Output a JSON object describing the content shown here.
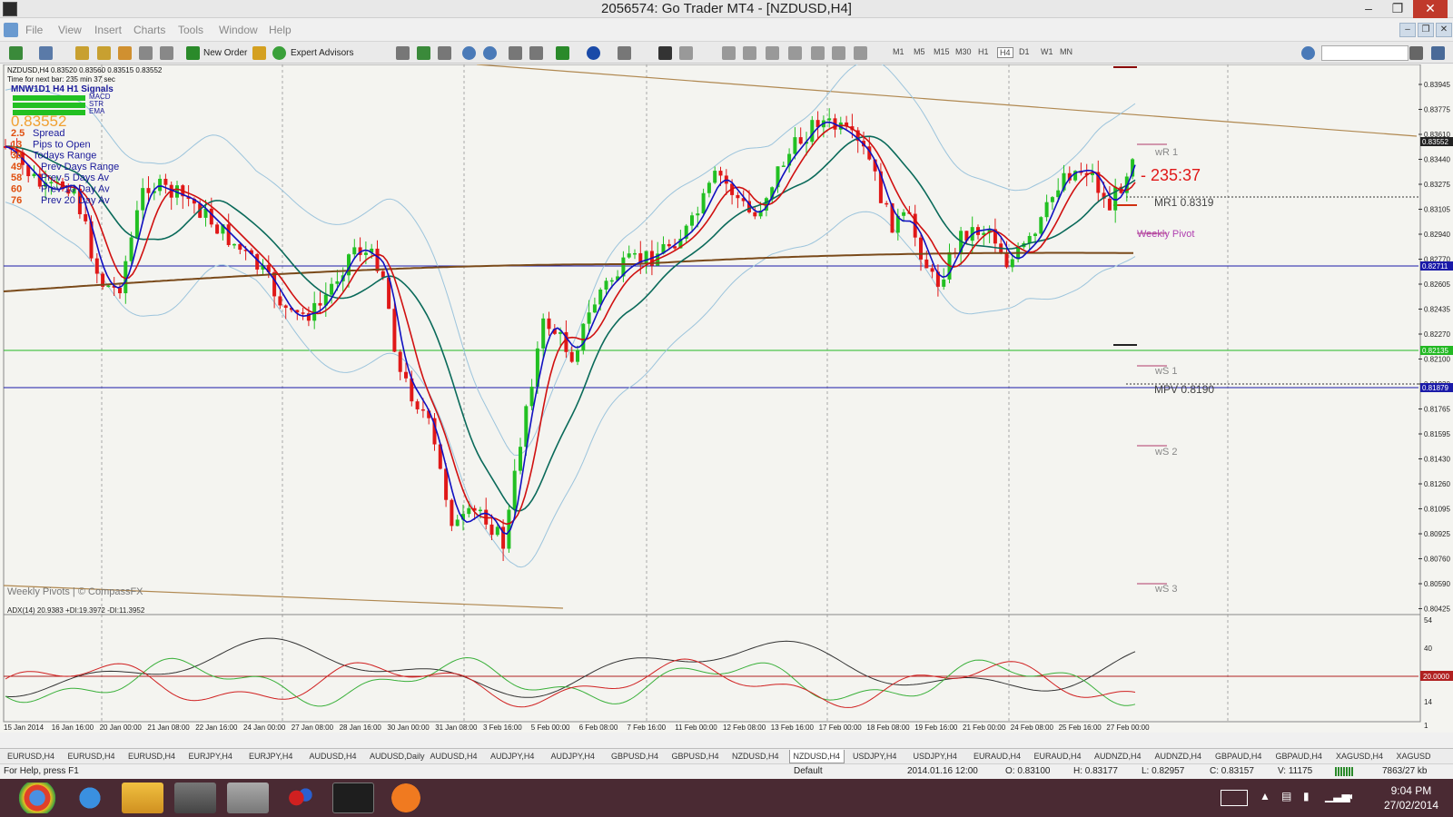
{
  "window": {
    "title": "2056574: Go Trader MT4 - [NZDUSD,H4]",
    "minimize": "–",
    "maximize": "❐",
    "close": "✕"
  },
  "menu": [
    "File",
    "View",
    "Insert",
    "Charts",
    "Tools",
    "Window",
    "Help"
  ],
  "toolbar": {
    "new_order": "New Order",
    "expert_advisors": "Expert Advisors",
    "timeframes": [
      "M1",
      "M5",
      "M15",
      "M30",
      "H1",
      "H4",
      "D1",
      "W1",
      "MN"
    ]
  },
  "chart": {
    "header": "NZDUSD,H4  0.83520 0.83560 0.83515 0.83552",
    "timer_line": "Time for next bar: 235 min 37 sec",
    "signals": "MNW1D1 H4 H1  Signals",
    "signal_rows": [
      "MACD",
      "STR",
      "EMA"
    ],
    "price_big": "0.83552",
    "info_rows": [
      {
        "value": "2.5",
        "label": "Spread"
      },
      {
        "value": "13",
        "label": "Pips to Open"
      },
      {
        "value": "38",
        "label": "Todays Range"
      },
      {
        "value": "49",
        "label": "Prev Days Range"
      },
      {
        "value": "58",
        "label": "Prev 5 Days Av"
      },
      {
        "value": "60",
        "label": "Prev 10 Day Av"
      },
      {
        "value": "76",
        "label": "Prev 20 Day Av"
      }
    ],
    "countdown": "- 235:37",
    "pivot_labels": {
      "wr1": "wR 1",
      "mr1": "MR1   0.8319",
      "weekly_pivot": "Weekly Pivot",
      "ws1": "wS 1",
      "mpv": "MPV   0.8190",
      "ws2": "wS 2",
      "ws3": "wS 3"
    },
    "watermark": "Weekly Pivots | © CompassFX",
    "price_scale": [
      "0.83945",
      "0.83775",
      "0.83610",
      "0.83440",
      "0.83275",
      "0.83105",
      "0.82940",
      "0.82770",
      "0.82605",
      "0.82435",
      "0.82270",
      "0.82100",
      "0.81930",
      "0.81765",
      "0.81595",
      "0.81430",
      "0.81260",
      "0.81095",
      "0.80925",
      "0.80760",
      "0.80590",
      "0.80425"
    ],
    "price_badges": [
      {
        "text": "0.83552",
        "bg": "#222222",
        "fg": "#ffffff"
      },
      {
        "text": "0.82711",
        "bg": "#1a1aa8",
        "fg": "#ffffff"
      },
      {
        "text": "0.82135",
        "bg": "#22b822",
        "fg": "#ffffff"
      },
      {
        "text": "0.81879",
        "bg": "#1a1aa8",
        "fg": "#ffffff"
      }
    ],
    "adx_header": "ADX(14) 20.9383 +DI:19.3972 -DI:11.3952",
    "adx_scale": [
      "54",
      "40",
      "27",
      "14",
      "1"
    ],
    "adx_badge": "20.0000",
    "time_labels": [
      "15 Jan 2014",
      "16 Jan 16:00",
      "20 Jan 00:00",
      "21 Jan 08:00",
      "22 Jan 16:00",
      "24 Jan 00:00",
      "27 Jan 08:00",
      "28 Jan 16:00",
      "30 Jan 00:00",
      "31 Jan 08:00",
      "3 Feb 16:00",
      "5 Feb 00:00",
      "6 Feb 08:00",
      "7 Feb 16:00",
      "11 Feb 00:00",
      "12 Feb 08:00",
      "13 Feb 16:00",
      "17 Feb 00:00",
      "18 Feb 08:00",
      "19 Feb 16:00",
      "21 Feb 00:00",
      "24 Feb 08:00",
      "25 Feb 16:00",
      "27 Feb 00:00"
    ]
  },
  "tabs": [
    "EURUSD,H4",
    "EURUSD,H4",
    "EURUSD,H4",
    "EURJPY,H4",
    "EURJPY,H4",
    "AUDUSD,H4",
    "AUDUSD,Daily",
    "AUDUSD,H4",
    "AUDJPY,H4",
    "AUDJPY,H4",
    "GBPUSD,H4",
    "GBPUSD,H4",
    "NZDUSD,H4",
    "NZDUSD,H4",
    "USDJPY,H4",
    "USDJPY,H4",
    "EURAUD,H4",
    "EURAUD,H4",
    "AUDNZD,H4",
    "AUDNZD,H4",
    "GBPAUD,H4",
    "GBPAUD,H4",
    "XAGUSD,H4",
    "XAGUSD"
  ],
  "active_tab": 13,
  "status": {
    "help": "For Help, press F1",
    "profile": "Default",
    "datetime": "2014.01.16 12:00",
    "open": "O: 0.83100",
    "high": "H: 0.83177",
    "low": "L: 0.82957",
    "close": "C: 0.83157",
    "volume": "V: 11175",
    "traffic": "7863/27 kb"
  },
  "taskbar": {
    "time": "9:04 PM",
    "date": "27/02/2014"
  },
  "colors": {
    "red_candle": "#e01818",
    "green_candle": "#22c022",
    "ema_fast": "#1010c0",
    "ema_slow": "#d01010",
    "ma_teal": "#0a6a5a",
    "ma_brown": "#7a4a1a",
    "bollinger": "#9cc4dc"
  }
}
